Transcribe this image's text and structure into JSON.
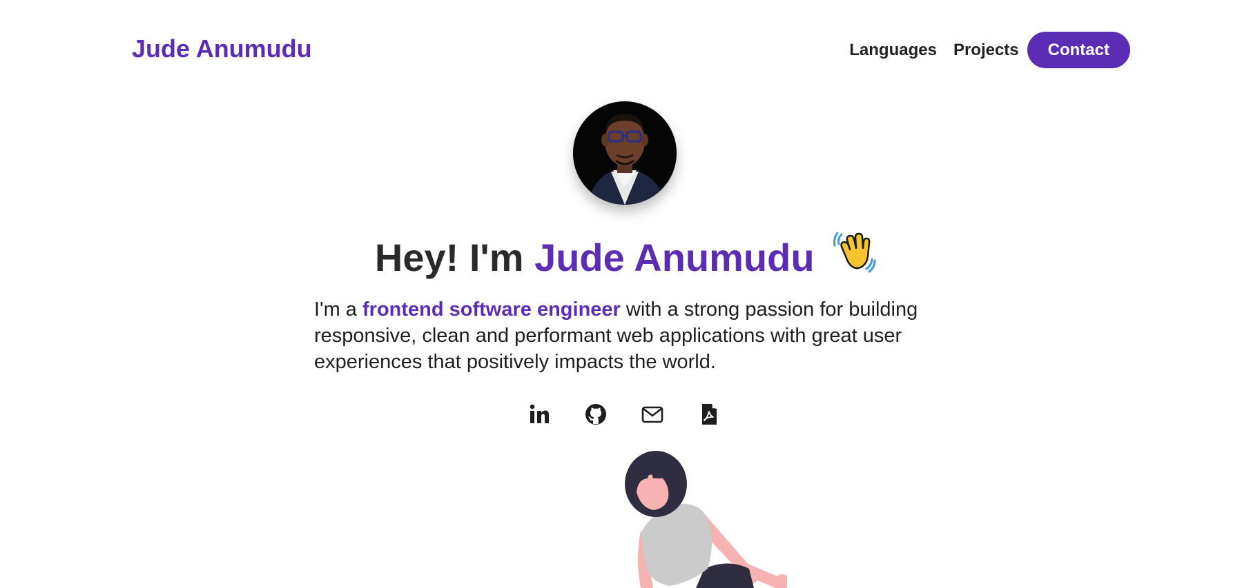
{
  "header": {
    "brand": "Jude Anumudu",
    "nav": {
      "languages": "Languages",
      "projects": "Projects",
      "contact": "Contact"
    }
  },
  "hero": {
    "title_prefix": "Hey! I'm ",
    "title_name": "Jude Anumudu",
    "wave_icon": "waving-hand-emoji",
    "desc_prefix": "I'm a ",
    "desc_highlight": "frontend software engineer",
    "desc_suffix": " with a strong passion for building responsive, clean and performant web applications with great user experiences that positively impacts the world."
  },
  "socials": [
    {
      "icon": "linkedin-icon"
    },
    {
      "icon": "github-icon"
    },
    {
      "icon": "mail-icon"
    },
    {
      "icon": "pdf-resume-icon"
    }
  ],
  "colors": {
    "accent": "#5b2db5",
    "text": "#222222",
    "background": "#ffffff"
  }
}
